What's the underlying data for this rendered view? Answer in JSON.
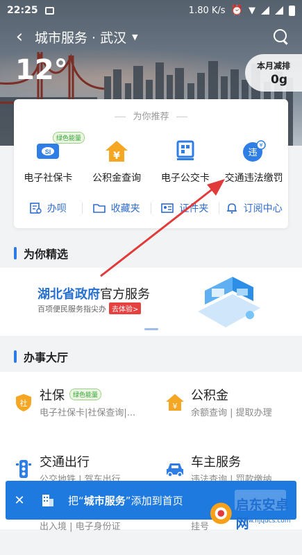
{
  "status_bar": {
    "time": "22:25",
    "speed": "1.80 K/s"
  },
  "title_bar": {
    "title": "城市服务 · 武汉"
  },
  "weather": {
    "temperature": "12°"
  },
  "emission": {
    "label": "本月减排",
    "value": "0g"
  },
  "recommend": {
    "title": "为你推荐",
    "services": [
      {
        "label": "电子社保卡",
        "badge": "绿色能量",
        "icon": "social-security-card-icon"
      },
      {
        "label": "公积金查询",
        "icon": "housing-fund-icon"
      },
      {
        "label": "电子公交卡",
        "icon": "bus-card-icon"
      },
      {
        "label": "交通违法缴罚",
        "icon": "traffic-violation-icon"
      }
    ],
    "quick_links": [
      {
        "label": "办呗",
        "icon": "task-icon"
      },
      {
        "label": "收藏夹",
        "icon": "folder-icon"
      },
      {
        "label": "证件夹",
        "icon": "id-card-icon"
      },
      {
        "label": "订阅中心",
        "icon": "bell-icon"
      }
    ]
  },
  "featured": {
    "title": "为你精选",
    "banner": {
      "title_blue": "湖北省政府",
      "title_black": "官方服务",
      "subtitle": "百项便民服务指尖办",
      "button": "去体验>"
    }
  },
  "hall": {
    "title": "办事大厅",
    "items": [
      {
        "name": "社保",
        "badge": "绿色能量",
        "desc": "电子社保卡|社保查询|...",
        "icon": "social-security-icon"
      },
      {
        "name": "公积金",
        "desc": "余额查询 | 提取办理",
        "icon": "housing-fund-icon"
      },
      {
        "name": "交通出行",
        "desc": "公交地铁 | 驾车出行",
        "icon": "traffic-light-icon"
      },
      {
        "name": "车主服务",
        "desc": "违法查询 | 罚款缴纳",
        "icon": "car-icon"
      },
      {
        "name": "",
        "desc": "出入境 | 电子身份证",
        "icon": ""
      },
      {
        "name": "",
        "desc": "挂号",
        "icon": ""
      }
    ]
  },
  "toast": {
    "prefix": "把“",
    "highlight": "城市服务",
    "suffix": "”添加到首页"
  },
  "watermark": {
    "text": "启东安卓网",
    "url": "www.hjqdcs.com"
  },
  "colors": {
    "accent": "#1f7ae0",
    "arrow": "#e03a3a",
    "badge_green": "#3aa33a"
  }
}
